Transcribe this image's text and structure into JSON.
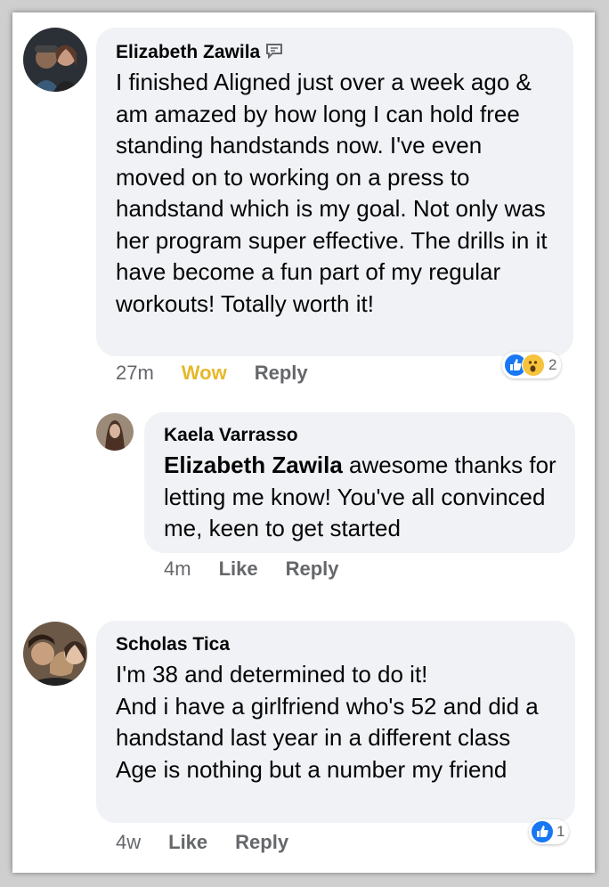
{
  "colors": {
    "accent_like": "#1877f2",
    "wow": "#e6b82a",
    "bubble_bg": "#f0f2f5",
    "meta_text": "#65676b"
  },
  "comments": [
    {
      "author": "Elizabeth Zawila",
      "author_icon": "messenger-badge-icon",
      "text": "I finished Aligned just over a week ago & am amazed by how long I can hold free standing handstands now. I've even moved on to working on a press to handstand which is my goal. Not only was her program super effective. The drills in it have become a fun part of my regular workouts! Totally worth it!",
      "time": "27m",
      "reaction_label": "Wow",
      "reply_label": "Reply",
      "reactions": [
        "like-icon",
        "wow-icon"
      ],
      "reaction_count": "2"
    },
    {
      "author": "Kaela Varrasso",
      "mention": "Elizabeth Zawila",
      "text": " awesome thanks for letting me know! You've all convinced me, keen to get started",
      "time": "4m",
      "reaction_label": "Like",
      "reply_label": "Reply"
    },
    {
      "author": "Scholas Tica",
      "lines": [
        "I'm 38 and determined to do it!",
        "And i have a girlfriend who's 52 and did a handstand last year in a different class",
        "Age is nothing but a number my friend"
      ],
      "time": "4w",
      "reaction_label": "Like",
      "reply_label": "Reply",
      "reactions": [
        "like-icon"
      ],
      "reaction_count": "1"
    }
  ]
}
